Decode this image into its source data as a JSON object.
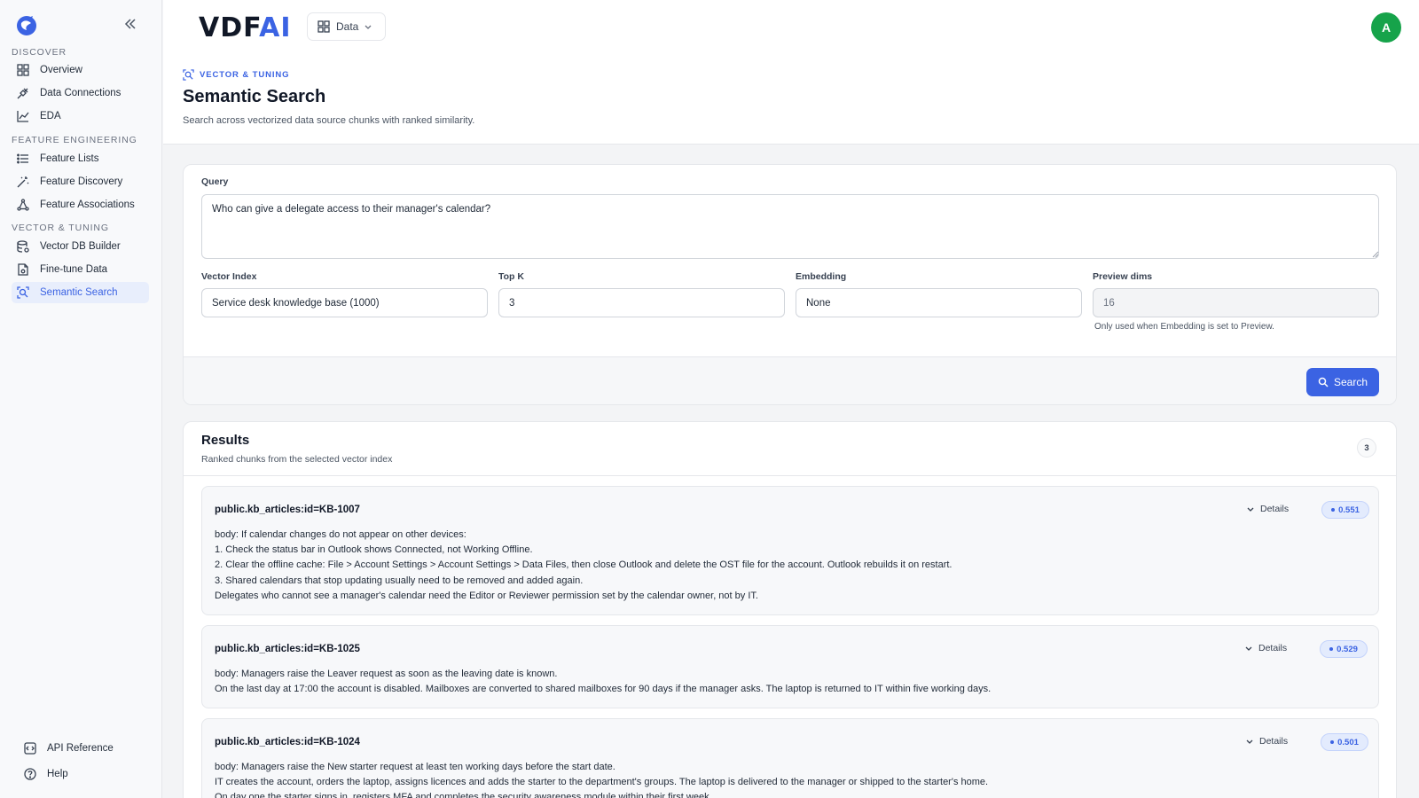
{
  "sidebar": {
    "sections": [
      "DISCOVER",
      "FEATURE ENGINEERING",
      "VECTOR & TUNING"
    ],
    "items": [
      {
        "label": "Overview",
        "icon": "grid-icon"
      },
      {
        "label": "Data Connections",
        "icon": "plug-icon"
      },
      {
        "label": "EDA",
        "icon": "chart-icon"
      },
      {
        "label": "Feature Lists",
        "icon": "list-icon"
      },
      {
        "label": "Feature Discovery",
        "icon": "wand-icon"
      },
      {
        "label": "Feature Associations",
        "icon": "network-icon"
      },
      {
        "label": "Vector DB Builder",
        "icon": "database-icon"
      },
      {
        "label": "Fine-tune Data",
        "icon": "file-icon"
      },
      {
        "label": "Semantic Search",
        "icon": "search-scan-icon",
        "active": true
      }
    ],
    "footer": [
      {
        "label": "API Reference",
        "icon": "api-icon"
      },
      {
        "label": "Help",
        "icon": "help-icon"
      }
    ]
  },
  "header": {
    "brand_main": "VDF",
    "brand_accent": "AI",
    "data_button": "Data",
    "avatar_initial": "A"
  },
  "page": {
    "breadcrumb": "VECTOR & TUNING",
    "title": "Semantic Search",
    "subtitle": "Search across vectorized data source chunks with ranked similarity."
  },
  "query": {
    "label": "Query",
    "value": "Who can give a delegate access to their manager's calendar?",
    "vector_index_label": "Vector Index",
    "vector_index_value": "Service desk knowledge base (1000)",
    "topk_label": "Top K",
    "topk_value": "3",
    "embedding_label": "Embedding",
    "embedding_value": "None",
    "preview_dims_label": "Preview dims",
    "preview_dims_value": "16",
    "preview_hint": "Only used when Embedding is set to Preview.",
    "search_button": "Search"
  },
  "results": {
    "title": "Results",
    "subtitle": "Ranked chunks from the selected vector index",
    "count": "3",
    "details_label": "Details",
    "items": [
      {
        "id": "public.kb_articles:id=KB-1007",
        "score": "0.551",
        "lines": [
          "body: If calendar changes do not appear on other devices:",
          "1. Check the status bar in Outlook shows Connected, not Working Offline.",
          "2. Clear the offline cache: File > Account Settings > Account Settings > Data Files, then close Outlook and delete the OST file for the account. Outlook rebuilds it on restart.",
          "3. Shared calendars that stop updating usually need to be removed and added again.",
          "Delegates who cannot see a manager's calendar need the Editor or Reviewer permission set by the calendar owner, not by IT."
        ]
      },
      {
        "id": "public.kb_articles:id=KB-1025",
        "score": "0.529",
        "lines": [
          "body: Managers raise the Leaver request as soon as the leaving date is known.",
          "On the last day at 17:00 the account is disabled. Mailboxes are converted to shared mailboxes for 90 days if the manager asks. The laptop is returned to IT within five working days."
        ]
      },
      {
        "id": "public.kb_articles:id=KB-1024",
        "score": "0.501",
        "lines": [
          "body: Managers raise the New starter request at least ten working days before the start date.",
          "IT creates the account, orders the laptop, assigns licences and adds the starter to the department's groups. The laptop is delivered to the manager or shipped to the starter's home.",
          "On day one the starter signs in, registers MFA and completes the security awareness module within their first week."
        ]
      }
    ]
  },
  "colors": {
    "accent": "#3b63e3",
    "avatar": "#16a34a"
  }
}
